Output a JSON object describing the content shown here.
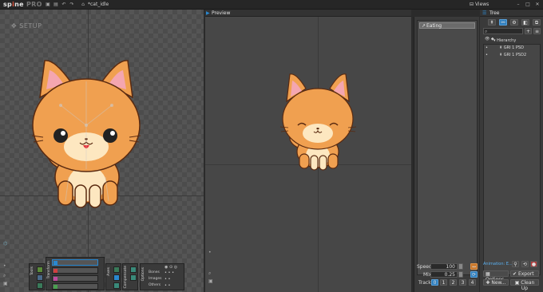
{
  "app": {
    "logo_main": "sp",
    "logo_i": "i",
    "logo_end": "ne",
    "logo_pro": "PRO",
    "project": "*cat_idle"
  },
  "topbar": {
    "views_label": "Views"
  },
  "setup": {
    "mode_label": "SETUP"
  },
  "preview": {
    "tab_label": "Preview"
  },
  "animations": {
    "items": [
      "Eating"
    ]
  },
  "controls": {
    "speed_label": "Speed:",
    "speed_value": "100",
    "mix_label": "Mix:",
    "mix_value": "0.25",
    "track_label": "Track:",
    "tracks": [
      "0",
      "1",
      "2",
      "3",
      "4"
    ]
  },
  "tree": {
    "title": "Tree",
    "hierarchy_label": "Hierarchy",
    "nodes": [
      "GRI 1 PSD",
      "GRI 1 PSD2"
    ],
    "animation_label": "Animation: E...",
    "options_label": "Options",
    "export_label": "Export",
    "new_label": "New...",
    "cleanup_label": "Clean Up"
  },
  "toolbar": {
    "tools_label": "Tools",
    "transform_label": "Transform",
    "axes_label": "Axes",
    "compensate_label": "Compensate",
    "options_label": "Options",
    "options_rows": [
      "Bones",
      "Images",
      "Others"
    ]
  },
  "colors": {
    "accent_blue": "#2f7fbf",
    "cat_orange": "#f0a050",
    "cat_cream": "#fde7c0"
  }
}
